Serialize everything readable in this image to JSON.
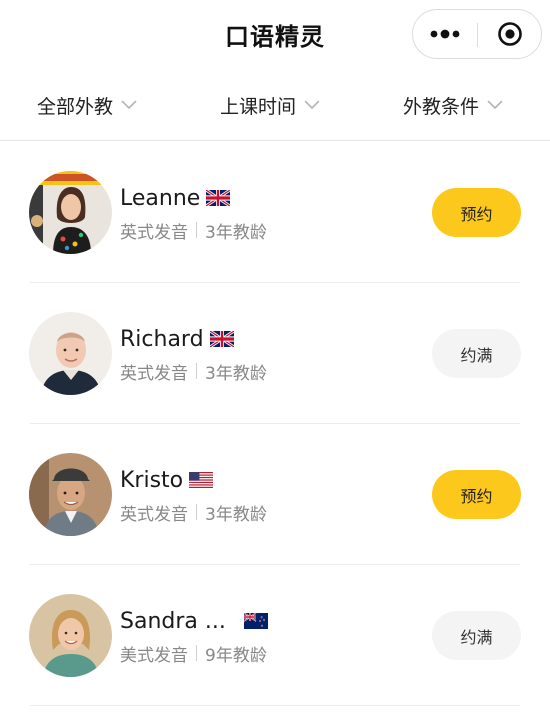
{
  "header": {
    "title": "口语精灵",
    "more_icon": "more-dots-icon",
    "close_icon": "target-close-icon"
  },
  "filters": [
    {
      "label": "全部外教",
      "icon": "chevron-down-icon"
    },
    {
      "label": "上课时间",
      "icon": "chevron-down-icon"
    },
    {
      "label": "外教条件",
      "icon": "chevron-down-icon"
    }
  ],
  "teachers": [
    {
      "name": "Leanne",
      "flag": "uk-flag-icon",
      "accent": "英式发音",
      "experience": "3年教龄",
      "button": "预约",
      "available": true
    },
    {
      "name": "Richard",
      "flag": "uk-flag-icon",
      "accent": "英式发音",
      "experience": "3年教龄",
      "button": "约满",
      "available": false
    },
    {
      "name": "Kristo",
      "flag": "us-flag-icon",
      "accent": "英式发音",
      "experience": "3年教龄",
      "button": "预约",
      "available": true
    },
    {
      "name": "Sandra ...",
      "flag": "nz-flag-icon",
      "accent": "美式发音",
      "experience": "9年教龄",
      "button": "约满",
      "available": false
    }
  ],
  "colors": {
    "book_button": "#fcc81b",
    "full_button": "#f4f4f4",
    "meta_text": "#888888"
  }
}
